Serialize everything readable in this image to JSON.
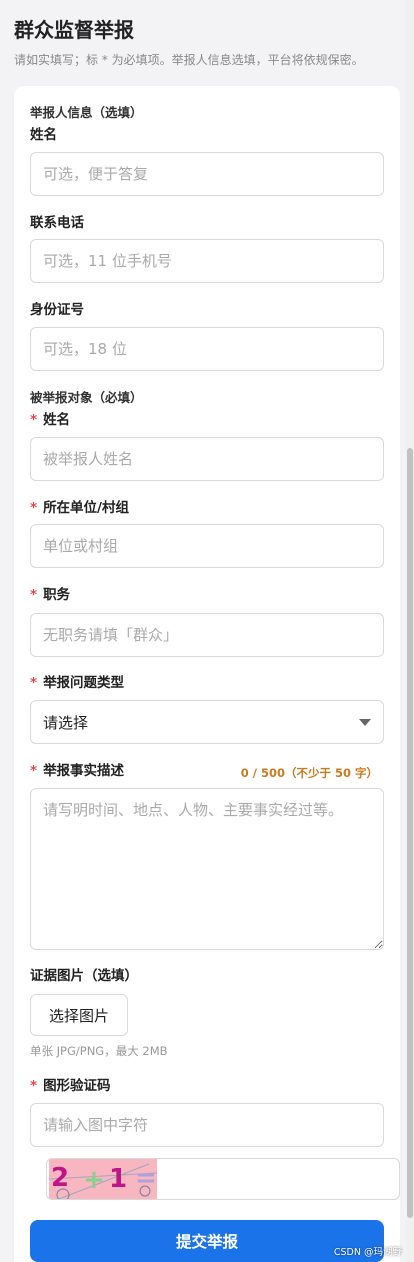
{
  "header": {
    "title": "群众监督举报",
    "subtitle": "请如实填写；标 * 为必填项。举报人信息选填，平台将依规保密。"
  },
  "reporter_section": {
    "title": "举报人信息（选填）",
    "name": {
      "label": "姓名",
      "placeholder": "可选，便于答复"
    },
    "phone": {
      "label": "联系电话",
      "placeholder": "可选，11 位手机号"
    },
    "id": {
      "label": "身份证号",
      "placeholder": "可选，18 位"
    }
  },
  "target_section": {
    "title": "被举报对象（必填）",
    "required_mark": "*",
    "name": {
      "label": "姓名",
      "placeholder": "被举报人姓名"
    },
    "unit": {
      "label": "所在单位/村组",
      "placeholder": "单位或村组"
    },
    "position": {
      "label": "职务",
      "placeholder": "无职务请填「群众」"
    },
    "type": {
      "label": "举报问题类型",
      "value": "请选择"
    },
    "desc": {
      "label": "举报事实描述",
      "counter": "0 / 500（不少于 50 字）",
      "placeholder": "请写明时间、地点、人物、主要事实经过等。"
    }
  },
  "evidence": {
    "label": "证据图片（选填）",
    "button": "选择图片",
    "hint": "单张 JPG/PNG，最大 2MB"
  },
  "captcha": {
    "label": "图形验证码",
    "placeholder": "请输入图中字符",
    "chars": [
      "2",
      "+",
      "1",
      "="
    ]
  },
  "submit_label": "提交举报",
  "watermark": "CSDN @玛湖野",
  "colors": {
    "accent": "#1a73e8",
    "required": "#e5484d",
    "counter": "#c97a1e",
    "captcha_bg": "#f7b6c0"
  }
}
